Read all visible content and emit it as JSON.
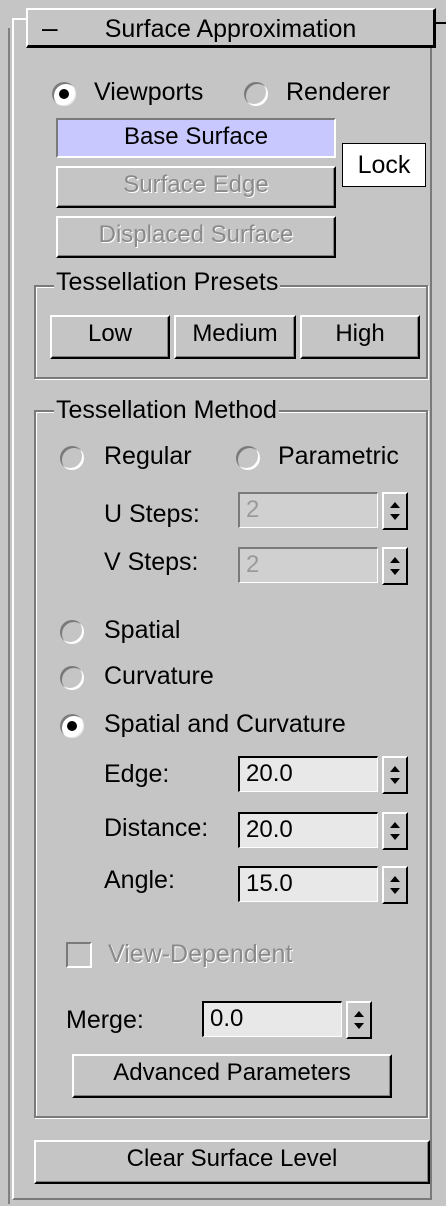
{
  "rollout": {
    "collapse_glyph": "–",
    "title": "Surface Approximation"
  },
  "mode": {
    "viewports_label": "Viewports",
    "renderer_label": "Renderer",
    "selected": "Viewports"
  },
  "surface_buttons": {
    "base": "Base Surface",
    "edge": "Surface Edge",
    "displaced": "Displaced Surface",
    "lock": "Lock"
  },
  "presets": {
    "title": "Tessellation Presets",
    "low": "Low",
    "medium": "Medium",
    "high": "High"
  },
  "method": {
    "title": "Tessellation Method",
    "regular": "Regular",
    "parametric": "Parametric",
    "u_steps_label": "U Steps:",
    "u_steps_value": "2",
    "v_steps_label": "V Steps:",
    "v_steps_value": "2",
    "spatial": "Spatial",
    "curvature": "Curvature",
    "spatial_curvature": "Spatial and Curvature",
    "selected": "Spatial and Curvature",
    "edge_label": "Edge:",
    "edge_value": "20.0",
    "distance_label": "Distance:",
    "distance_value": "20.0",
    "angle_label": "Angle:",
    "angle_value": "15.0",
    "view_dependent_label": "View-Dependent",
    "view_dependent_checked": false,
    "merge_label": "Merge:",
    "merge_value": "0.0",
    "advanced_button": "Advanced Parameters"
  },
  "clear_button": "Clear Surface Level",
  "colors": {
    "panel_bg": "#c5c5c5",
    "active_button_bg": "#c8c8ff",
    "disabled_text": "#8a8a8a"
  },
  "icons": [
    "radio-icon",
    "spinner-up-icon",
    "spinner-down-icon",
    "checkbox-icon"
  ]
}
